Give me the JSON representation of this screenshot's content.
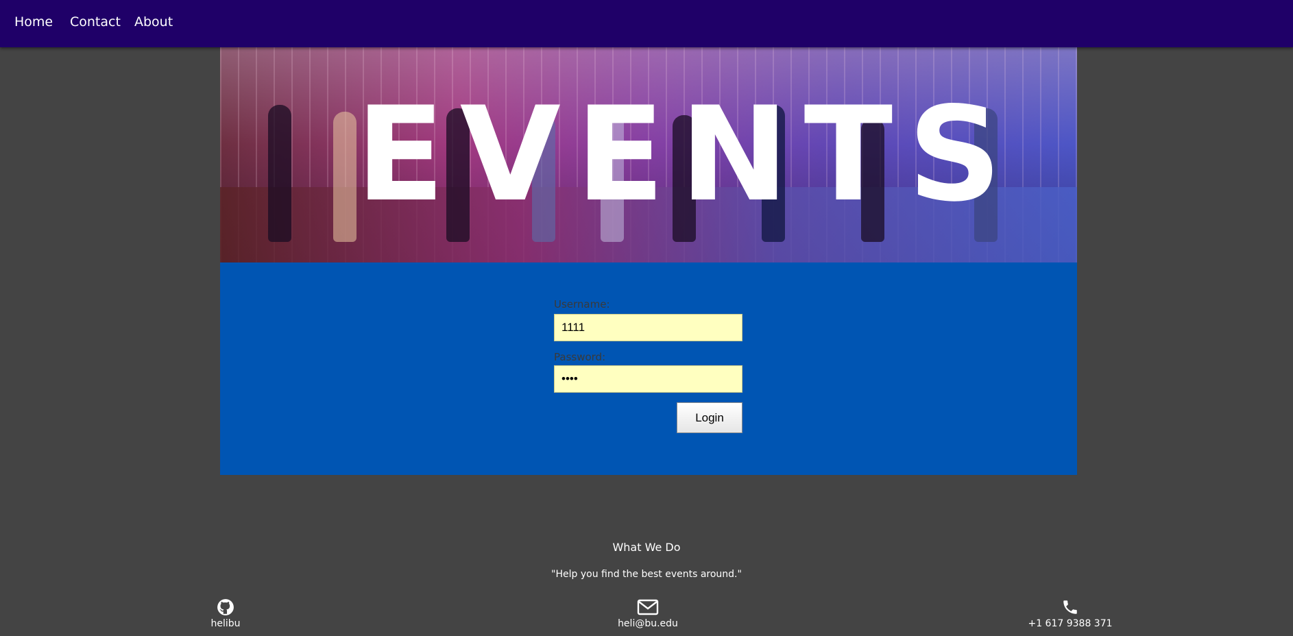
{
  "nav": {
    "items": [
      {
        "label": "Home"
      },
      {
        "label": "Contact"
      },
      {
        "label": "About"
      }
    ]
  },
  "hero": {
    "title": "EVENTS"
  },
  "login": {
    "username_label": "Username:",
    "username_value": "1111",
    "password_label": "Password:",
    "password_value": "••••",
    "button_label": "Login"
  },
  "footer": {
    "heading": "What We Do",
    "tagline": "\"Help you find the best events around.\"",
    "contacts": [
      {
        "icon": "github-icon",
        "text": "helibu"
      },
      {
        "icon": "mail-icon",
        "text": "heli@bu.edu"
      },
      {
        "icon": "phone-icon",
        "text": "+1 617 9388 371"
      }
    ]
  },
  "colors": {
    "navbar": "#1f0068",
    "page_background": "#444444",
    "login_panel": "#0055b3",
    "input_background": "#ffffc0"
  }
}
